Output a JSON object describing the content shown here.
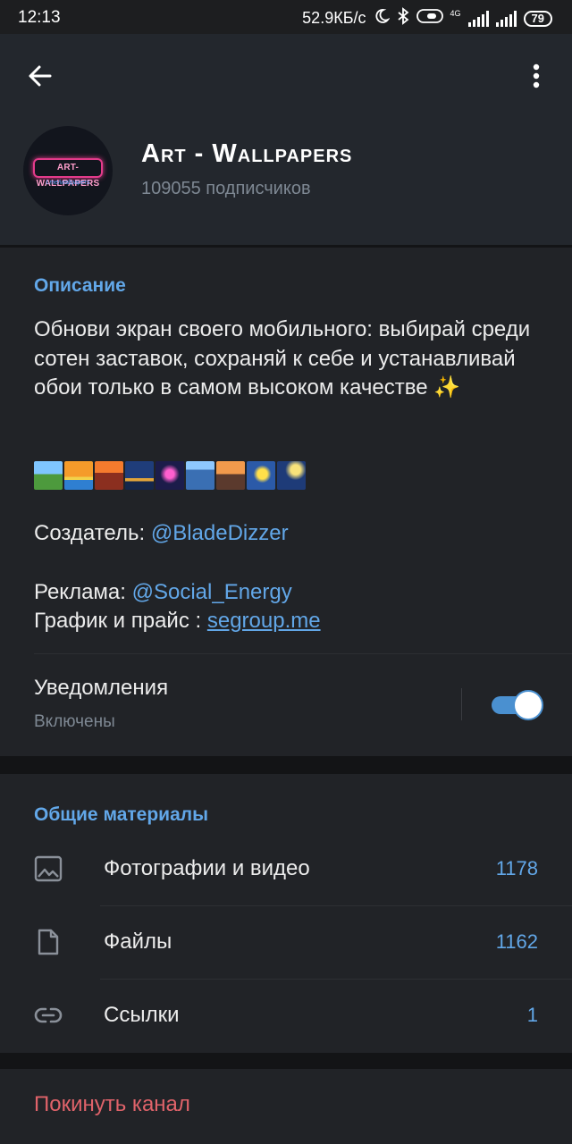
{
  "status_bar": {
    "time": "12:13",
    "net_speed": "52.9КБ/с",
    "network": "4G",
    "battery": "79"
  },
  "header": {
    "channel_title": "Art - Wallpapers",
    "subscribers": "109055 подписчиков",
    "avatar_text": "ART-WALLPAPERS",
    "avatar_subtext": "t.me/wallpapers"
  },
  "description": {
    "section_title": "Описание",
    "text": "Обнови экран своего мобильного: выбирай среди сотен заставок, сохраняй к себе и устанавливай обои только в самом высоком качестве ✨",
    "emoji_icons": [
      "picture-of-landscape",
      "sunrise",
      "sunset-city",
      "bridge-at-night",
      "fireworks",
      "cityscape",
      "mountain-sunrise",
      "star-night",
      "moon-night"
    ],
    "creator_label": "Создатель:",
    "creator_link": "@BladeDizzer",
    "ads_label": "Реклама:",
    "ads_link": "@Social_Energy",
    "price_label": "График и прайс :",
    "price_link": "segroup.me"
  },
  "notifications": {
    "label": "Уведомления",
    "state": "Включены",
    "enabled": true
  },
  "shared_media": {
    "section_title": "Общие материалы",
    "items": [
      {
        "icon": "photo-icon",
        "label": "Фотографии и видео",
        "count": "1178"
      },
      {
        "icon": "file-icon",
        "label": "Файлы",
        "count": "1162"
      },
      {
        "icon": "link-icon",
        "label": "Ссылки",
        "count": "1"
      }
    ]
  },
  "leave": {
    "label": "Покинуть канал"
  },
  "colors": {
    "accent": "#62a7e8",
    "danger": "#e0636a",
    "header_bg": "#23272d",
    "section_bg": "#212327"
  }
}
